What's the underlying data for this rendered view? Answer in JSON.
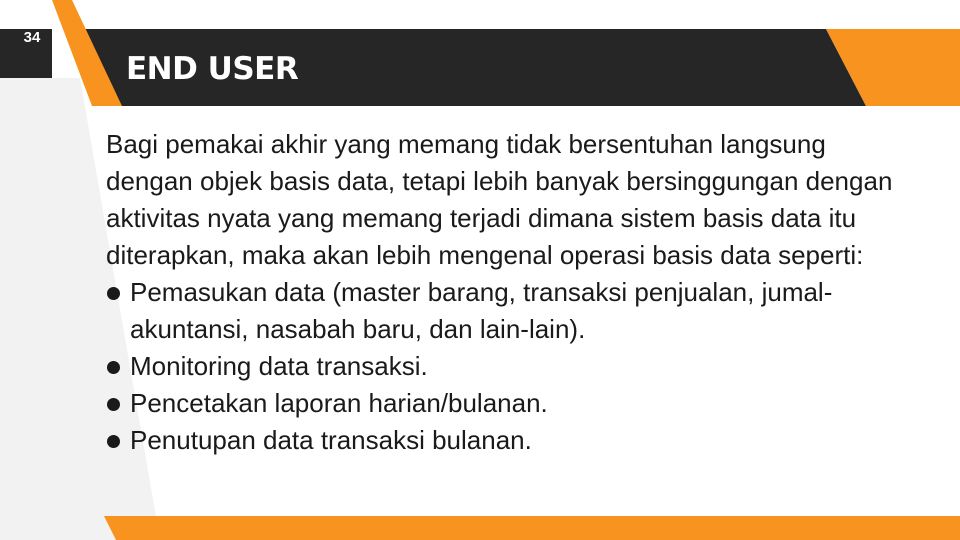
{
  "slide": {
    "number": "34",
    "title": "END USER"
  },
  "colors": {
    "dark": "#262626",
    "accent": "#f7931e",
    "light_panel": "#f2f2f2",
    "text": "#1a1a1a"
  },
  "content": {
    "intro": "Bagi pemakai akhir yang memang tidak bersentuhan langsung dengan objek basis data, tetapi lebih banyak bersinggungan dengan aktivitas nyata yang memang terjadi dimana sistem basis data itu diterapkan, maka akan lebih mengenal operasi basis data seperti:",
    "bullets": [
      "Pemasukan data (master barang, transaksi penjualan, jumal-akuntansi, nasabah baru, dan lain-lain).",
      "Monitoring data transaksi.",
      "Pencetakan laporan harian/bulanan.",
      "Penutupan data transaksi bulanan."
    ]
  }
}
